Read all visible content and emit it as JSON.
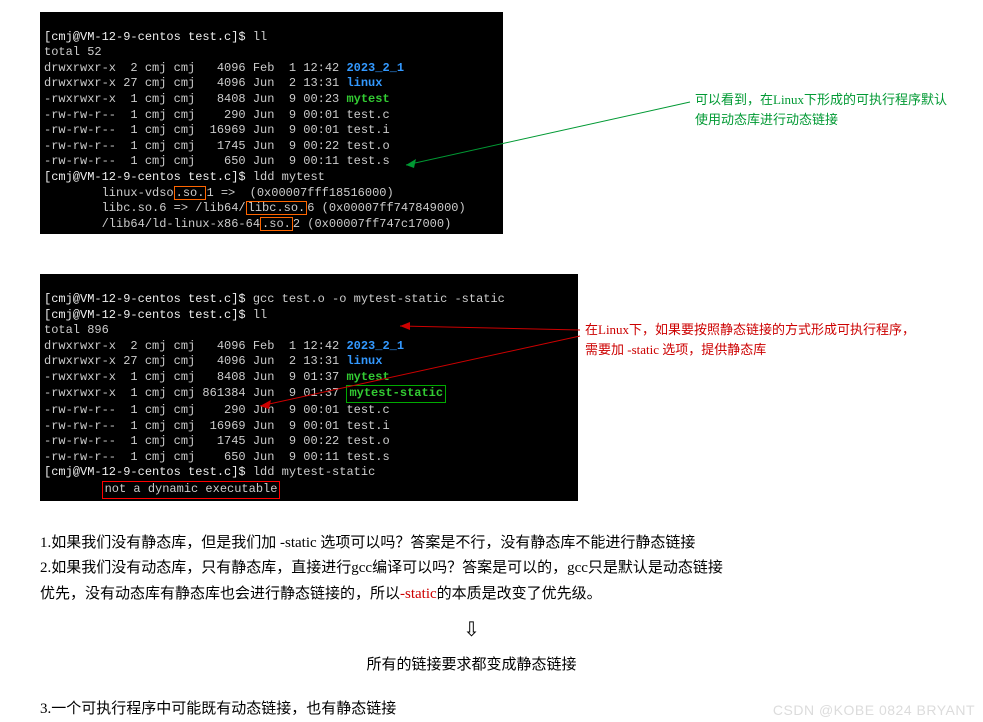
{
  "term1": {
    "line1_prompt": "[cmj@VM-12-9-centos test.c]$ ",
    "line1_cmd": "ll",
    "line2": "total 52",
    "line3a": "drwxrwxr-x  2 cmj cmj   4096 Feb  1 12:42 ",
    "line3b": "2023_2_1",
    "line4a": "drwxrwxr-x 27 cmj cmj   4096 Jun  2 13:31 ",
    "line4b": "linux",
    "line5a": "-rwxrwxr-x  1 cmj cmj   8408 Jun  9 00:23 ",
    "line5b": "mytest",
    "line6": "-rw-rw-r--  1 cmj cmj    290 Jun  9 00:01 test.c",
    "line7": "-rw-rw-r--  1 cmj cmj  16969 Jun  9 00:01 test.i",
    "line8": "-rw-rw-r--  1 cmj cmj   1745 Jun  9 00:22 test.o",
    "line9": "-rw-rw-r--  1 cmj cmj    650 Jun  9 00:11 test.s",
    "line10_prompt": "[cmj@VM-12-9-centos test.c]$ ",
    "line10_cmd": "ldd mytest",
    "line11a": "        linux-vdso",
    "line11b": ".so.",
    "line11c": "1 =>  (0x00007fff18516000)",
    "line12a": "        libc.so.6 => /lib64/",
    "line12b": "libc.so.",
    "line12c": "6 (0x00007ff747849000)",
    "line13a": "        /lib64/ld-linux-x86-64",
    "line13b": ".so.",
    "line13c": "2 (0x00007ff747c17000)"
  },
  "anno1": {
    "l1": "可以看到，在Linux下形成的可执行程序默认",
    "l2": "使用动态库进行动态链接"
  },
  "term2": {
    "line1_prompt": "[cmj@VM-12-9-centos test.c]$ ",
    "line1_cmd": "gcc test.o -o mytest-static -static",
    "line2_prompt": "[cmj@VM-12-9-centos test.c]$ ",
    "line2_cmd": "ll",
    "line3": "total 896",
    "line4a": "drwxrwxr-x  2 cmj cmj   4096 Feb  1 12:42 ",
    "line4b": "2023_2_1",
    "line5a": "drwxrwxr-x 27 cmj cmj   4096 Jun  2 13:31 ",
    "line5b": "linux",
    "line6a": "-rwxrwxr-x  1 cmj cmj   8408 Jun  9 01:37 ",
    "line6b": "mytest",
    "line7a": "-rwxrwxr-x  1 cmj cmj 861384 Jun  9 01:37 ",
    "line7b": "mytest-static",
    "line8": "-rw-rw-r--  1 cmj cmj    290 Jun  9 00:01 test.c",
    "line9": "-rw-rw-r--  1 cmj cmj  16969 Jun  9 00:01 test.i",
    "line10": "-rw-rw-r--  1 cmj cmj   1745 Jun  9 00:22 test.o",
    "line11": "-rw-rw-r--  1 cmj cmj    650 Jun  9 00:11 test.s",
    "line12_prompt": "[cmj@VM-12-9-centos test.c]$ ",
    "line12_cmd": "ldd mytest-static",
    "line13": "not a dynamic executable"
  },
  "anno2": {
    "l1": "在Linux下，如果要按照静态链接的方式形成可执行程序，",
    "l2": "需要加 -static 选项，提供静态库"
  },
  "body": {
    "p1": "1.如果我们没有静态库，但是我们加 -static 选项可以吗？答案是不行，没有静态库不能进行静态链接",
    "p2a": "2.如果我们没有动态库，只有静态库，直接进行gcc编译可以吗？答案是可以的，gcc只是默认是动态链接",
    "p2b_a": "优先，没有动态库有静态库也会进行静态链接的，所以",
    "p2b_red": "-static",
    "p2b_c": "的本质是改变了优先级。",
    "arrow": "⇩",
    "center": "所有的链接要求都变成静态链接",
    "p3": "3.一个可执行程序中可能既有动态链接，也有静态链接"
  },
  "watermark": "CSDN @KOBE 0824 BRYANT"
}
